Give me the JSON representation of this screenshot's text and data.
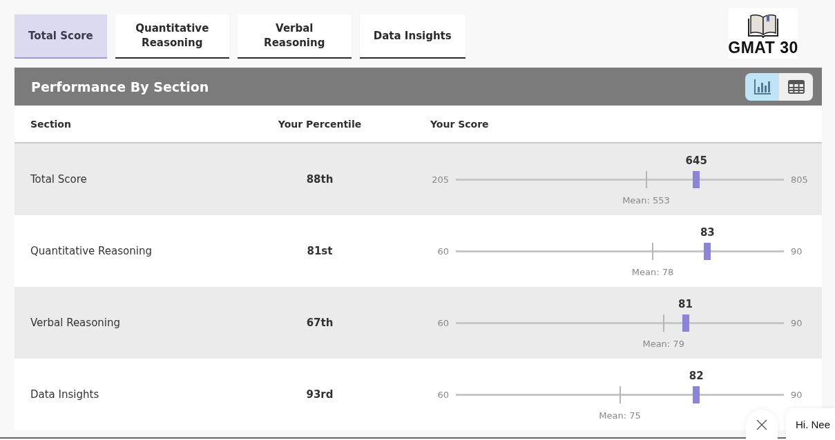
{
  "tabs": [
    {
      "label": "Total Score",
      "selected": true
    },
    {
      "label": "Quantitative Reasoning",
      "selected": false
    },
    {
      "label": "Verbal Reasoning",
      "selected": false
    },
    {
      "label": "Data Insights",
      "selected": false
    }
  ],
  "logo": {
    "text": "GMAT 30"
  },
  "panel": {
    "title": "Performance By Section",
    "view_toggle": [
      {
        "kind": "chart",
        "selected": true
      },
      {
        "kind": "table",
        "selected": false
      }
    ],
    "columns": [
      "Section",
      "Your Percentile",
      "Your Score"
    ],
    "rows": [
      {
        "section": "Total Score",
        "percentile": "88th",
        "score": {
          "value": "645",
          "min": "205",
          "max": "805",
          "level": 0.733,
          "mean": {
            "label": "Mean: 553",
            "level": 0.58
          }
        }
      },
      {
        "section": "Quantitative Reasoning",
        "percentile": "81st",
        "score": {
          "value": "83",
          "min": "60",
          "max": "90",
          "level": 0.767,
          "mean": {
            "label": "Mean: 78",
            "level": 0.6
          }
        }
      },
      {
        "section": "Verbal Reasoning",
        "percentile": "67th",
        "score": {
          "value": "81",
          "min": "60",
          "max": "90",
          "level": 0.7,
          "mean": {
            "label": "Mean: 79",
            "level": 0.633
          }
        }
      },
      {
        "section": "Data Insights",
        "percentile": "93rd",
        "score": {
          "value": "82",
          "min": "60",
          "max": "90",
          "level": 0.733,
          "mean": {
            "label": "Mean: 75",
            "level": 0.5
          }
        }
      }
    ]
  },
  "chat": {
    "greeting": "Hi. Nee"
  }
}
